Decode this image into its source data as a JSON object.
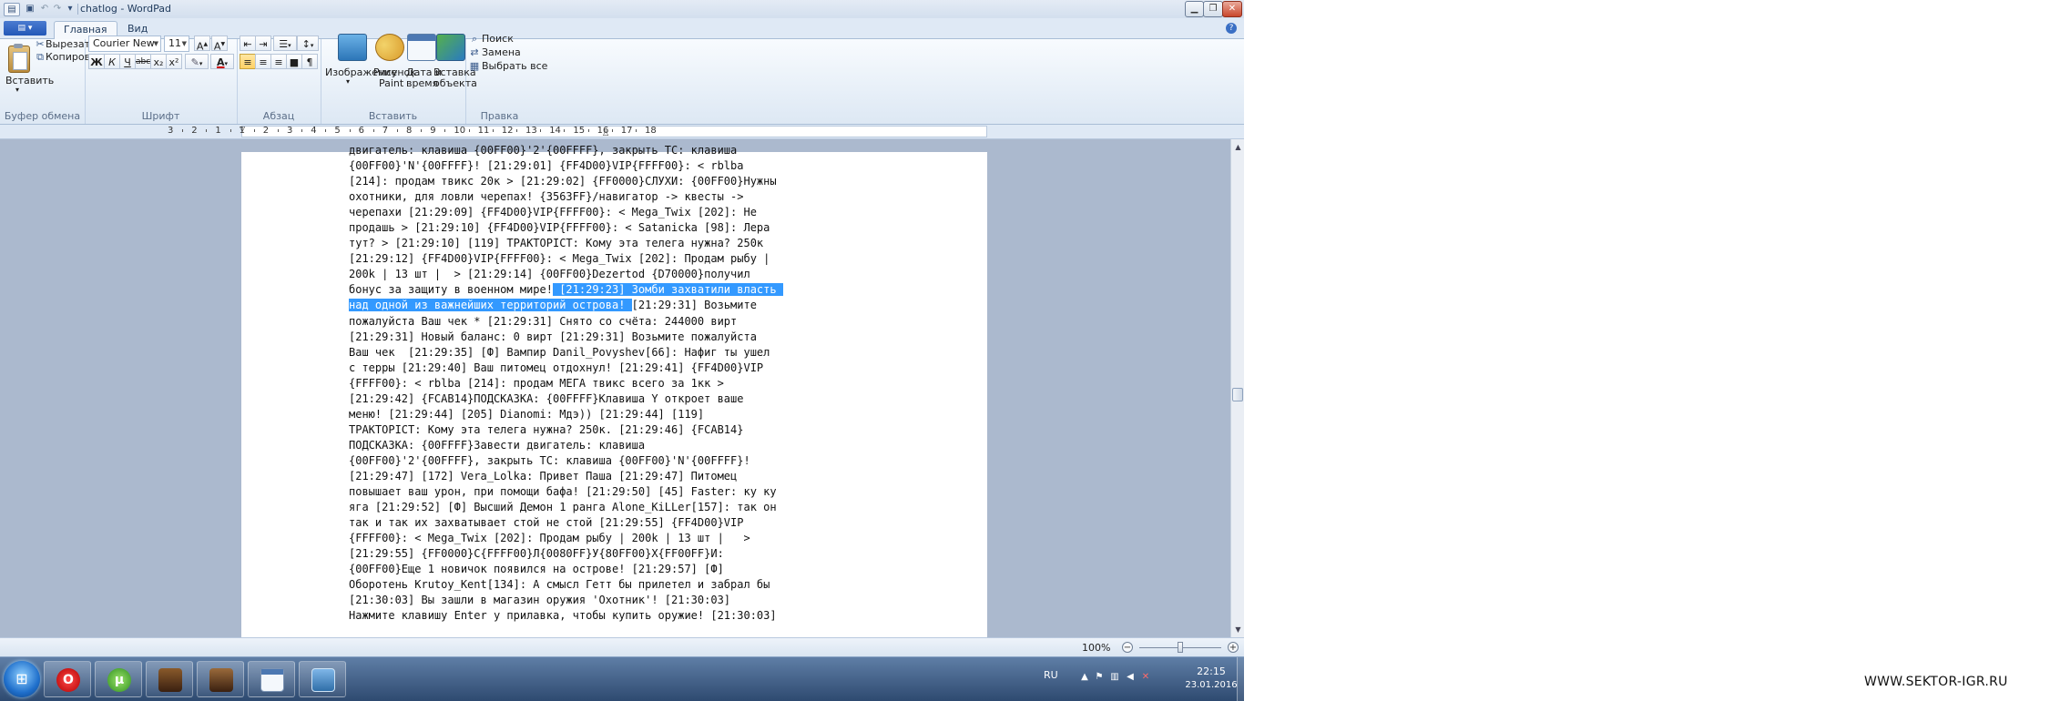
{
  "window": {
    "title": "chatlog - WordPad",
    "caption_buttons": [
      "minimize",
      "maximize",
      "close"
    ]
  },
  "quick_access": {
    "icons": [
      "save-icon",
      "undo-icon",
      "redo-icon",
      "customize-icon"
    ]
  },
  "ribbon_tabs": [
    {
      "label": "Главная",
      "active": true
    },
    {
      "label": "Вид",
      "active": false
    }
  ],
  "clipboard": {
    "paste_label": "Вставить",
    "cut_label": "Вырезать",
    "copy_label": "Копировать",
    "group_label": "Буфер обмена"
  },
  "font": {
    "family": "Courier New",
    "size": "11",
    "group_label": "Шрифт",
    "buttons": [
      "Ж",
      "К",
      "Ч",
      "abc",
      "x₂",
      "x²"
    ]
  },
  "paragraph": {
    "group_label": "Абзац"
  },
  "insert": {
    "image_label": "Изображение",
    "paint_label_1": "Рисунок",
    "paint_label_2": "Paint",
    "datetime_label_1": "Дата и",
    "datetime_label_2": "время",
    "object_label_1": "Вставка",
    "object_label_2": "объекта",
    "group_label": "Вставить"
  },
  "editing": {
    "find_label": "Поиск",
    "replace_label": "Замена",
    "select_all_label": "Выбрать все",
    "group_label": "Правка"
  },
  "ruler": {
    "labels": [
      "3",
      "2",
      "1",
      "1",
      "2",
      "3",
      "4",
      "5",
      "6",
      "7",
      "8",
      "9",
      "10",
      "11",
      "12",
      "13",
      "14",
      "15",
      "16",
      "17",
      "18"
    ]
  },
  "document": {
    "text_before_selection": "двигатель: клавиша {00FF00}'2'{00FFFF}, закрыть ТС: клавиша\n{00FF00}'N'{00FFFF}! [21:29:01] {FF4D00}VIP{FFFF00}: < rblba\n[214]: продам твикс 20к > [21:29:02] {FF0000}СЛУХИ: {00FF00}Нужны\nохотники, для ловли черепах! {3563FF}/навигатор -> квесты ->\nчерепахи [21:29:09] {FF4D00}VIP{FFFF00}: < Mega_Twix [202]: Не\nпродашь > [21:29:10] {FF4D00}VIP{FFFF00}: < Satanicka [98]: Лера\nтут? > [21:29:10] [119] ТРАКТОРIСТ: Кому эта телега нужна? 250к\n[21:29:12] {FF4D00}VIP{FFFF00}: < Mega_Twix [202]: Продам рыбу |\n200k | 13 шт |  > [21:29:14] {00FF00}Dezertod {D70000}получил\nбонус за защиту в военном мире!",
    "selected_text_line1": " [21:29:23] Зомби захватили власть ",
    "selected_text_line2": "над одной из важнейших территорий острова! ",
    "text_after_selection": "[21:29:31] Возьмите\nпожалуйста Ваш чек * [21:29:31] Снято со счёта: 244000 вирт\n[21:29:31] Новый баланс: 0 вирт [21:29:31] Возьмите пожалуйста\nВаш чек  [21:29:35] [Ф] Вампир Danil_Povyshev[66]: Нафиг ты ушел\nс терры [21:29:40] Ваш питомец отдохнул! [21:29:41] {FF4D00}VIP\n{FFFF00}: < rblba [214]: продам МЕГА твикс всего за 1кк >\n[21:29:42] {FCAB14}ПОДСКАЗКА: {00FFFF}Клавиша Y откроет ваше\nменю! [21:29:44] [205] Dianomi: Мдэ)) [21:29:44] [119]\nТРАКТОРIСТ: Кому эта телега нужна? 250к. [21:29:46] {FCAB14}\nПОДСКАЗКА: {00FFFF}Завести двигатель: клавиша\n{00FF00}'2'{00FFFF}, закрыть ТС: клавиша {00FF00}'N'{00FFFF}!\n[21:29:47] [172] Vera_Lolka: Привет Паша [21:29:47] Питомец\nповышает ваш урон, при помощи бафа! [21:29:50] [45] Faster: ку ку\nяга [21:29:52] [Ф] Высший Демон 1 ранга Alone_KiLLer[157]: так он\nтак и так их захватывает стой не стой [21:29:55] {FF4D00}VIP\n{FFFF00}: < Mega_Twix [202]: Продам рыбу | 200k | 13 шт |   >\n[21:29:55] {FF0000}С{FFFF00}Л{0080FF}У{80FF00}Х{FF00FF}И:\n{00FF00}Еще 1 новичок появился на острове! [21:29:57] [Ф]\nОборотень Krutoy_Kent[134]: А смысл Гетт бы прилетел и забрал бы\n[21:30:03] Вы зашли в магазин оружия 'Охотник'! [21:30:03]\nНажмите клавишу Enter у прилавка, чтобы купить оружие! [21:30:03]"
  },
  "statusbar": {
    "zoom": "100%",
    "zoom_level_percent": 100
  },
  "taskbar": {
    "apps": [
      "opera",
      "utorrent",
      "game-a",
      "game-b",
      "wordpad",
      "image-viewer"
    ],
    "language": "RU",
    "time": "22:15",
    "date": "23.01.2016"
  },
  "watermark": "WWW.SEKTOR-IGR.RU",
  "colors": {
    "selection": "#3399ff",
    "ribbon_bg": "#dde8f4",
    "doc_background": "#abb9ce",
    "taskbar": "#2e4a70"
  }
}
